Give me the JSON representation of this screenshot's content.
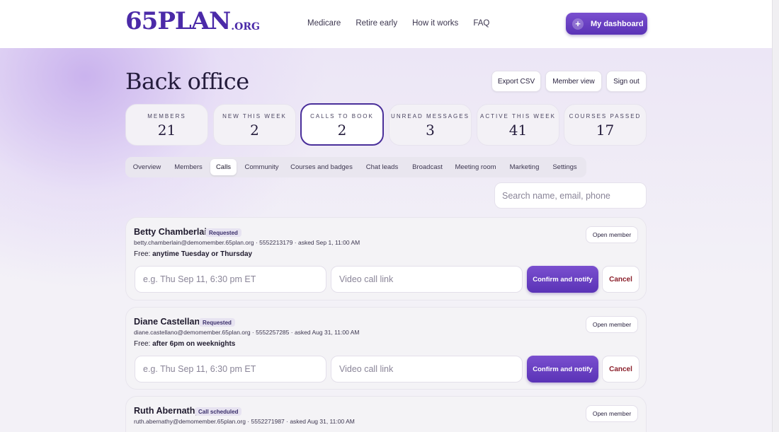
{
  "nav": {
    "logo_main": "65PLAN",
    "logo_suffix": ".ORG",
    "links": [
      "Medicare",
      "Retire early",
      "How it works",
      "FAQ"
    ],
    "dashboard_label": "My dashboard"
  },
  "page": {
    "title": "Back office",
    "buttons": {
      "export": "Export CSV",
      "member_view": "Member view",
      "sign_out": "Sign out"
    }
  },
  "stats": [
    {
      "label": "Members",
      "value": "21"
    },
    {
      "label": "New this week",
      "value": "2"
    },
    {
      "label": "Calls to book",
      "value": "2"
    },
    {
      "label": "Unread messages",
      "value": "3"
    },
    {
      "label": "Active this week",
      "value": "41"
    },
    {
      "label": "Courses passed",
      "value": "17"
    }
  ],
  "tabs": [
    "Overview",
    "Members",
    "Calls",
    "Community",
    "Courses and badges",
    "Chat leads",
    "Broadcast",
    "Meeting room",
    "Marketing",
    "Settings"
  ],
  "active_tab": "Calls",
  "search": {
    "placeholder": "Search name, email, phone"
  },
  "calls": [
    {
      "name": "Betty Chamberlain",
      "status": "Requested",
      "meta": "betty.chamberlain@demomember.65plan.org · 5552213179 · asked Sep 1, 11:00 AM",
      "free_prefix": "Free:",
      "free_value": "anytime Tuesday or Thursday",
      "open_label": "Open member",
      "date_placeholder": "e.g. Thu Sep 11, 6:30 pm ET",
      "link_placeholder": "Video call link",
      "confirm_label": "Confirm and notify",
      "cancel_label": "Cancel"
    },
    {
      "name": "Diane Castellano",
      "status": "Requested",
      "meta": "diane.castellano@demomember.65plan.org · 5552257285 · asked Aug 31, 11:00 AM",
      "free_prefix": "Free:",
      "free_value": "after 6pm on weeknights",
      "open_label": "Open member",
      "date_placeholder": "e.g. Thu Sep 11, 6:30 pm ET",
      "link_placeholder": "Video call link",
      "confirm_label": "Confirm and notify",
      "cancel_label": "Cancel"
    },
    {
      "name": "Ruth Abernathy",
      "status": "Call scheduled",
      "meta": "ruth.abernathy@demomember.65plan.org · 5552271987 · asked Aug 31, 11:00 AM",
      "open_label": "Open member"
    }
  ],
  "colors": {
    "brand": "#5a33b6",
    "brand_light": "#7a4fcf",
    "cancel": "#8a1f2a"
  }
}
